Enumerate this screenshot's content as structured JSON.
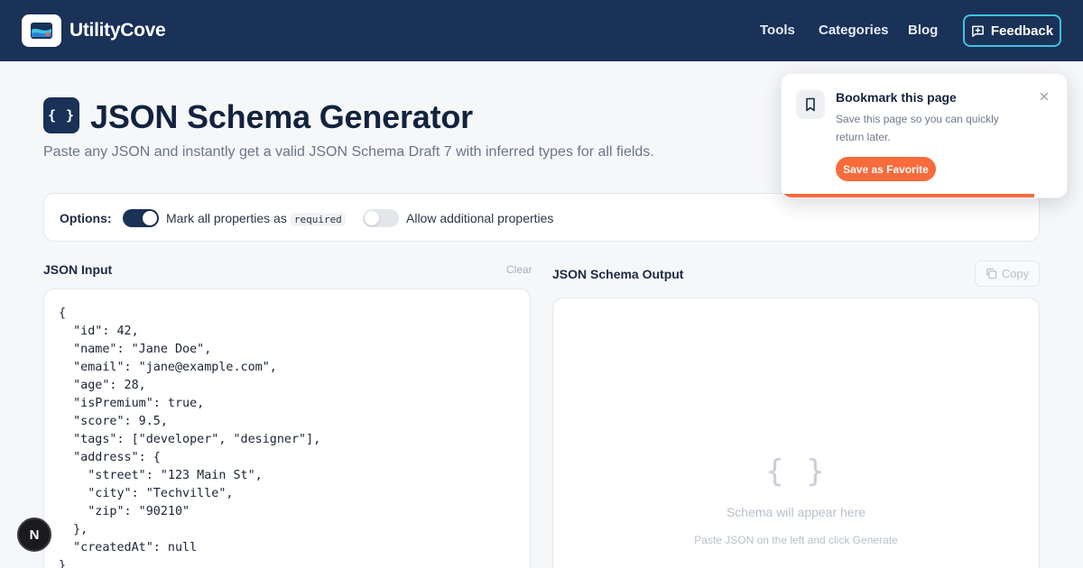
{
  "brand": {
    "name": "UtilityCove"
  },
  "nav": {
    "tools": "Tools",
    "categories": "Categories",
    "blog": "Blog",
    "feedback": "Feedback"
  },
  "hero": {
    "icon_text": "{ }",
    "title": "JSON Schema Generator",
    "subtitle": "Paste any JSON and instantly get a valid JSON Schema Draft 7 with inferred types for all fields."
  },
  "options": {
    "label": "Options:",
    "required": {
      "text": "Mark all properties as",
      "code": "required",
      "enabled": true
    },
    "additional": {
      "text": "Allow additional properties",
      "enabled": false
    }
  },
  "input": {
    "label": "JSON Input",
    "clear": "Clear",
    "value": "{\n  \"id\": 42,\n  \"name\": \"Jane Doe\",\n  \"email\": \"jane@example.com\",\n  \"age\": 28,\n  \"isPremium\": true,\n  \"score\": 9.5,\n  \"tags\": [\"developer\", \"designer\"],\n  \"address\": {\n    \"street\": \"123 Main St\",\n    \"city\": \"Techville\",\n    \"zip\": \"90210\"\n  },\n  \"createdAt\": null\n}"
  },
  "output": {
    "label": "JSON Schema Output",
    "copy": "Copy",
    "empty_icon": "{ }",
    "empty_title": "Schema will appear here",
    "empty_sub": "Paste JSON on the left and click Generate"
  },
  "toast": {
    "title": "Bookmark this page",
    "text": "Save this page so you can quickly return later.",
    "button": "Save as Favorite"
  },
  "badge": {
    "letter": "N"
  },
  "colors": {
    "navy": "#1a3158",
    "accent": "#3dc3e0",
    "orange": "#f76b3c"
  }
}
